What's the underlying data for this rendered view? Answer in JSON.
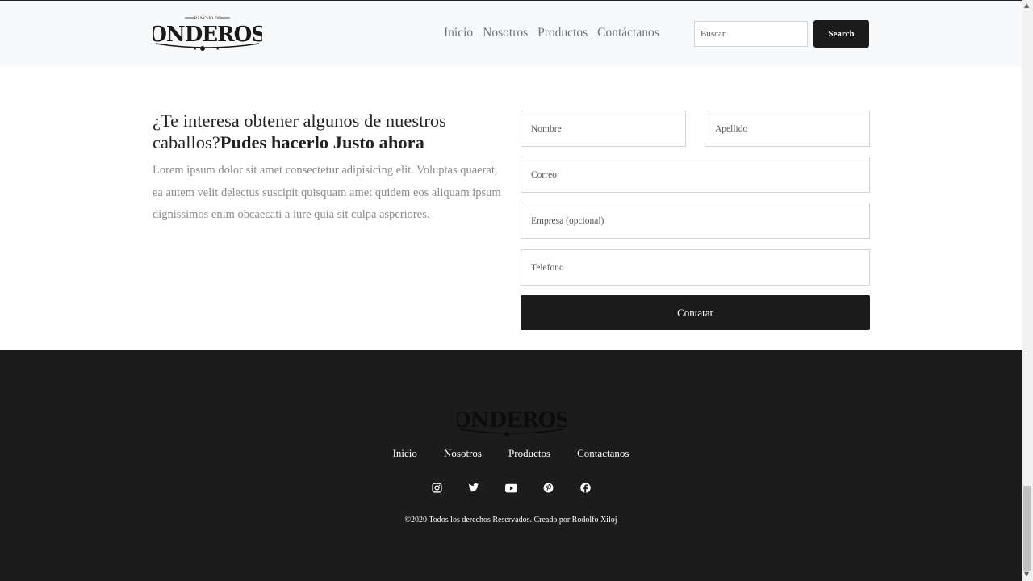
{
  "header": {
    "logo_small_text": "RANCHO DE",
    "logo_text": "PONDEROSA",
    "nav": [
      "Inicio",
      "Nosotros",
      "Productos",
      "Contáctanos"
    ],
    "search_placeholder": "Buscar",
    "search_button": "Search"
  },
  "contact": {
    "heading_plain": "¿Te interesa obtener algunos de nuestros caballos?",
    "heading_bold": "Pudes hacerlo Justo ahora",
    "paragraph": "Lorem ipsum dolor sit amet consectetur adipisicing elit. Voluptas quaerat, ea autem velit delectus suscipit quisquam amet quidem eos aliquam ipsum dignissimos enim obcaecati a iure quia sit culpa asperiores.",
    "fields": {
      "nombre": "Nombre",
      "apellido": "Apellido",
      "correo": "Correo",
      "empresa": "Empresa (opcional)",
      "telefono": "Telefono"
    },
    "submit": "Contatar"
  },
  "footer": {
    "logo_text": "PONDEROSA",
    "nav": [
      "Inicio",
      "Nosotros",
      "Productos",
      "Contactanos"
    ],
    "social_icons": [
      "instagram-icon",
      "twitter-icon",
      "youtube-icon",
      "pinterest-icon",
      "facebook-icon"
    ],
    "copyright": "©2020 Todos los derechos Reservados. Creado por Rodolfo Xiloj"
  },
  "colors": {
    "header_bg": "#f8f9fa",
    "dark": "#1b1b1b",
    "footer_bg": "#1c1c1c",
    "muted_text": "#8a8a8a"
  }
}
